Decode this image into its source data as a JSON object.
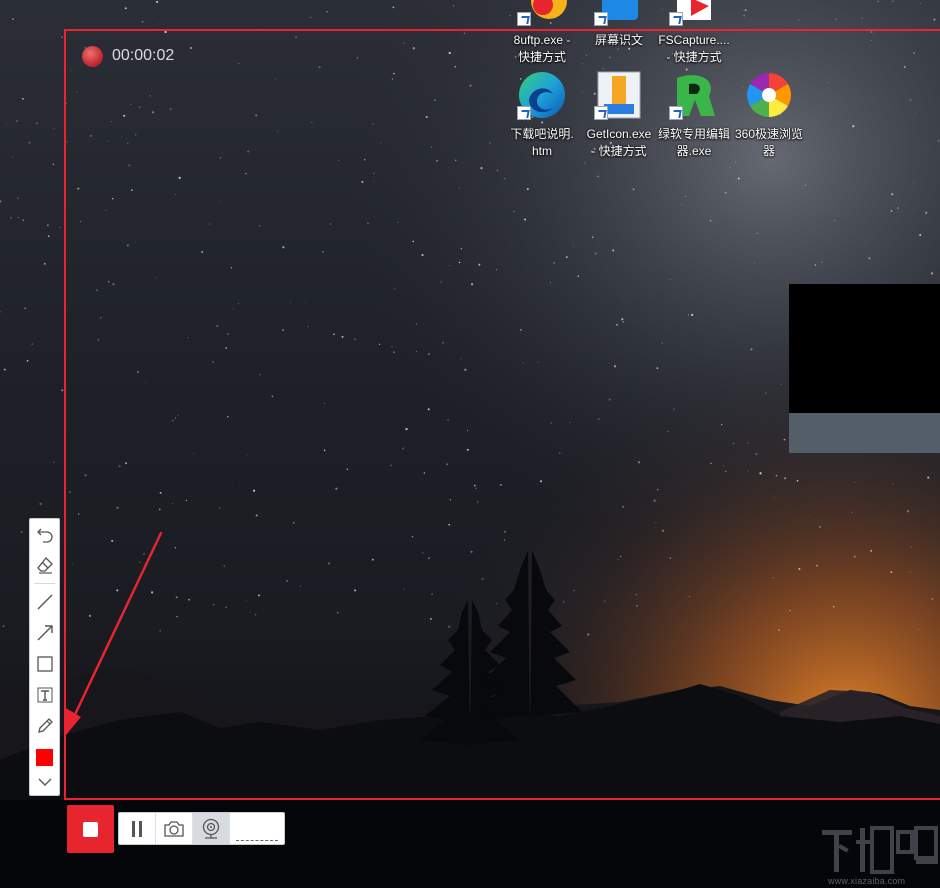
{
  "recorder": {
    "elapsed_time": "00:00:02",
    "accent_color": "#e8242f",
    "frame_color": "#e8242f",
    "annotation_color": "#ff0000"
  },
  "annotation_toolbar": {
    "tools": [
      {
        "name": "undo",
        "icon": "undo-icon"
      },
      {
        "name": "eraser",
        "icon": "eraser-icon"
      },
      {
        "name": "line",
        "icon": "line-icon"
      },
      {
        "name": "arrow",
        "icon": "arrow-icon"
      },
      {
        "name": "rectangle",
        "icon": "rectangle-icon"
      },
      {
        "name": "text",
        "icon": "text-icon"
      },
      {
        "name": "pencil",
        "icon": "pencil-icon"
      },
      {
        "name": "color",
        "icon": "color-swatch"
      },
      {
        "name": "collapse",
        "icon": "chevron-down-icon"
      }
    ]
  },
  "controls": {
    "stop": {
      "icon": "stop-icon"
    },
    "pause": {
      "icon": "pause-icon"
    },
    "screenshot": {
      "icon": "camera-icon"
    },
    "webcam": {
      "icon": "webcam-icon",
      "active": true
    }
  },
  "desktop": {
    "icons_row1": [
      {
        "label": "8uftp.exe -\n快捷方式",
        "icon": "ftp-app-icon"
      },
      {
        "label": "屏幕识文",
        "icon": "screen-ocr-icon"
      },
      {
        "label": "FSCapture....\n- 快捷方式",
        "icon": "fscapture-icon"
      }
    ],
    "icons_row2": [
      {
        "label": "下载吧说明.\nhtm",
        "icon": "edge-browser-icon"
      },
      {
        "label": "GetIcon.exe\n- 快捷方式",
        "icon": "geticon-app-icon"
      },
      {
        "label": "绿软专用编辑\n器.exe",
        "icon": "green-editor-icon"
      },
      {
        "label": "360极速浏览\n器",
        "icon": "360-browser-icon"
      }
    ]
  },
  "watermark": {
    "logo_text": "下载吧",
    "url": "www.xiazaiba.com"
  }
}
